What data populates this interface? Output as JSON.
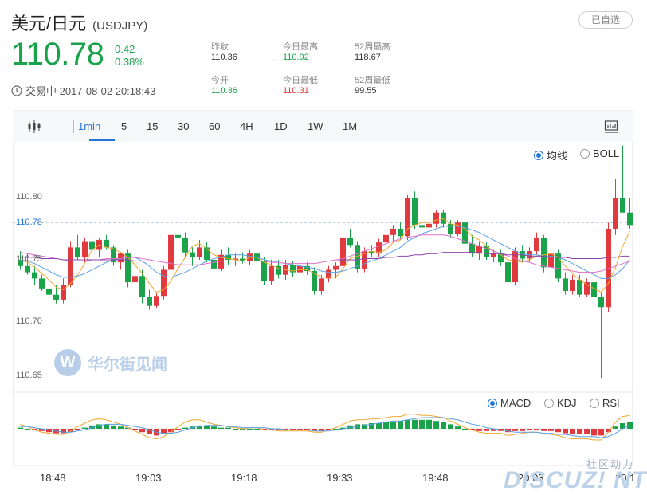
{
  "header": {
    "title": "美元/日元",
    "code": "(USDJPY)",
    "fav_label": "已自选",
    "price": "110.78",
    "change": "0.42",
    "change_pct": "0.38%",
    "status": "交易中 2017-08-02 20:18:43",
    "stats": [
      {
        "label": "昨收",
        "value": "110.36",
        "color": "#333333"
      },
      {
        "label": "今日最高",
        "value": "110.92",
        "color": "#1aa34a"
      },
      {
        "label": "52周最高",
        "value": "118.67",
        "color": "#333333"
      },
      {
        "label": "今开",
        "value": "110.36",
        "color": "#1aa34a"
      },
      {
        "label": "今日最低",
        "value": "110.31",
        "color": "#e0393e"
      },
      {
        "label": "52周最低",
        "value": "99.55",
        "color": "#333333"
      }
    ]
  },
  "toolbar": {
    "periods": [
      "1min",
      "5",
      "15",
      "30",
      "60",
      "4H",
      "1D",
      "1W",
      "1M"
    ],
    "active": "1min"
  },
  "indicators": {
    "main": [
      "均线",
      "BOLL"
    ],
    "main_active": "均线",
    "sub": [
      "MACD",
      "KDJ",
      "RSI"
    ],
    "sub_active": "MACD"
  },
  "watermark": {
    "logo": "W",
    "text": "华尔街见闻"
  },
  "forum_watermark": {
    "small": "社区动力",
    "big": "DISCUZ! NT"
  },
  "colors": {
    "up": "#e0393e",
    "down": "#1aa34a",
    "accent": "#2176d4"
  },
  "chart_data": {
    "type": "candlestick",
    "ylim": [
      110.63,
      110.86
    ],
    "yticks": [
      "110.80",
      "110.78",
      "110.75",
      "110.70",
      "110.65"
    ],
    "ytick_values": [
      110.8,
      110.78,
      110.75,
      110.7,
      110.65
    ],
    "highlight_tick": "110.78",
    "xticks": [
      "18:48",
      "19:03",
      "19:18",
      "19:33",
      "19:48",
      "20:03",
      "20:1"
    ],
    "ohlc": [
      [
        110.75,
        110.757,
        110.742,
        110.745
      ],
      [
        110.745,
        110.755,
        110.738,
        110.74
      ],
      [
        110.74,
        110.745,
        110.73,
        110.735
      ],
      [
        110.735,
        110.738,
        110.725,
        110.727
      ],
      [
        110.727,
        110.732,
        110.718,
        110.722
      ],
      [
        110.722,
        110.73,
        110.715,
        110.718
      ],
      [
        110.718,
        110.735,
        110.715,
        110.73
      ],
      [
        110.73,
        110.765,
        110.728,
        110.76
      ],
      [
        110.76,
        110.77,
        110.75,
        110.752
      ],
      [
        110.752,
        110.768,
        110.748,
        110.765
      ],
      [
        110.765,
        110.77,
        110.755,
        110.758
      ],
      [
        110.758,
        110.768,
        110.752,
        110.766
      ],
      [
        110.766,
        110.77,
        110.758,
        110.76
      ],
      [
        110.76,
        110.762,
        110.745,
        110.748
      ],
      [
        110.748,
        110.756,
        110.742,
        110.755
      ],
      [
        110.755,
        110.758,
        110.728,
        110.732
      ],
      [
        110.732,
        110.74,
        110.725,
        110.737
      ],
      [
        110.737,
        110.742,
        110.715,
        110.72
      ],
      [
        110.72,
        110.726,
        110.71,
        110.713
      ],
      [
        110.713,
        110.723,
        110.711,
        110.721
      ],
      [
        110.721,
        110.745,
        110.718,
        110.742
      ],
      [
        110.742,
        110.775,
        110.74,
        110.77
      ],
      [
        110.77,
        110.777,
        110.762,
        110.768
      ],
      [
        110.768,
        110.772,
        110.752,
        110.756
      ],
      [
        110.756,
        110.76,
        110.745,
        110.752
      ],
      [
        110.752,
        110.766,
        110.75,
        110.76
      ],
      [
        110.76,
        110.764,
        110.748,
        110.75
      ],
      [
        110.75,
        110.753,
        110.74,
        110.743
      ],
      [
        110.743,
        110.758,
        110.741,
        110.754
      ],
      [
        110.754,
        110.76,
        110.746,
        110.75
      ],
      [
        110.75,
        110.755,
        110.745,
        110.751
      ],
      [
        110.751,
        110.756,
        110.747,
        110.749
      ],
      [
        110.749,
        110.758,
        110.746,
        110.755
      ],
      [
        110.755,
        110.76,
        110.746,
        110.749
      ],
      [
        110.749,
        110.752,
        110.73,
        110.733
      ],
      [
        110.733,
        110.75,
        110.73,
        110.745
      ],
      [
        110.745,
        110.75,
        110.735,
        110.738
      ],
      [
        110.738,
        110.75,
        110.734,
        110.746
      ],
      [
        110.746,
        110.749,
        110.736,
        110.74
      ],
      [
        110.74,
        110.748,
        110.737,
        110.745
      ],
      [
        110.745,
        110.748,
        110.738,
        110.741
      ],
      [
        110.741,
        110.744,
        110.722,
        110.725
      ],
      [
        110.725,
        110.738,
        110.722,
        110.735
      ],
      [
        110.735,
        110.745,
        110.732,
        110.742
      ],
      [
        110.742,
        110.748,
        110.735,
        110.745
      ],
      [
        110.745,
        110.77,
        110.742,
        110.768
      ],
      [
        110.768,
        110.775,
        110.76,
        110.762
      ],
      [
        110.762,
        110.765,
        110.74,
        110.743
      ],
      [
        110.743,
        110.76,
        110.74,
        110.757
      ],
      [
        110.757,
        110.762,
        110.752,
        110.755
      ],
      [
        110.755,
        110.767,
        110.752,
        110.764
      ],
      [
        110.764,
        110.772,
        110.757,
        110.77
      ],
      [
        110.77,
        110.778,
        110.765,
        110.775
      ],
      [
        110.775,
        110.78,
        110.766,
        110.769
      ],
      [
        110.769,
        110.802,
        110.766,
        110.8
      ],
      [
        110.8,
        110.805,
        110.775,
        110.778
      ],
      [
        110.778,
        110.782,
        110.77,
        110.776
      ],
      [
        110.776,
        110.782,
        110.772,
        110.779
      ],
      [
        110.779,
        110.79,
        110.776,
        110.788
      ],
      [
        110.788,
        110.79,
        110.776,
        110.779
      ],
      [
        110.779,
        110.782,
        110.768,
        110.771
      ],
      [
        110.771,
        110.782,
        110.769,
        110.78
      ],
      [
        110.78,
        110.782,
        110.76,
        110.763
      ],
      [
        110.763,
        110.77,
        110.752,
        110.755
      ],
      [
        110.755,
        110.765,
        110.75,
        110.761
      ],
      [
        110.761,
        110.764,
        110.75,
        110.752
      ],
      [
        110.752,
        110.758,
        110.748,
        110.755
      ],
      [
        110.755,
        110.758,
        110.745,
        110.748
      ],
      [
        110.748,
        110.752,
        110.728,
        110.732
      ],
      [
        110.732,
        110.76,
        110.73,
        110.757
      ],
      [
        110.757,
        110.762,
        110.748,
        110.751
      ],
      [
        110.751,
        110.76,
        110.748,
        110.757
      ],
      [
        110.757,
        110.772,
        110.754,
        110.768
      ],
      [
        110.768,
        110.77,
        110.74,
        110.744
      ],
      [
        110.744,
        110.758,
        110.74,
        110.755
      ],
      [
        110.755,
        110.758,
        110.732,
        110.735
      ],
      [
        110.735,
        110.74,
        110.722,
        110.725
      ],
      [
        110.725,
        110.738,
        110.722,
        110.734
      ],
      [
        110.734,
        110.738,
        110.72,
        110.722
      ],
      [
        110.722,
        110.735,
        110.72,
        110.732
      ],
      [
        110.732,
        110.74,
        110.715,
        110.72
      ],
      [
        110.72,
        110.724,
        110.655,
        110.712
      ],
      [
        110.712,
        110.78,
        110.708,
        110.775
      ],
      [
        110.775,
        110.815,
        110.77,
        110.8
      ],
      [
        110.8,
        110.842,
        110.79,
        110.788
      ],
      [
        110.788,
        110.8,
        110.775,
        110.778
      ]
    ],
    "ma": [
      {
        "name": "MA5",
        "color": "#f0a830",
        "values": [
          110.75,
          110.748,
          110.744,
          110.739,
          110.734,
          110.728,
          110.726,
          110.731,
          110.738,
          110.747,
          110.758,
          110.762,
          110.76,
          110.759,
          110.756,
          110.752,
          110.746,
          110.739,
          110.731,
          110.724,
          110.726,
          110.733,
          110.743,
          110.752,
          110.761,
          110.763,
          110.759,
          110.754,
          110.752,
          110.751,
          110.75,
          110.749,
          110.752,
          110.752,
          110.748,
          110.746,
          110.743,
          110.742,
          110.741,
          110.742,
          110.742,
          110.739,
          110.736,
          110.736,
          110.736,
          110.743,
          110.751,
          110.753,
          110.755,
          110.757,
          110.756,
          110.758,
          110.764,
          110.766,
          110.775,
          110.778,
          110.78,
          110.78,
          110.782,
          110.783,
          110.779,
          110.778,
          110.775,
          110.769,
          110.766,
          110.761,
          110.757,
          110.754,
          110.75,
          110.749,
          110.748,
          110.75,
          110.753,
          110.754,
          110.755,
          110.752,
          110.745,
          110.739,
          110.734,
          110.73,
          110.727,
          110.724,
          110.731,
          110.744,
          110.761,
          110.773
        ]
      },
      {
        "name": "MA10",
        "color": "#5aa0e6",
        "values": [
          110.75,
          110.749,
          110.747,
          110.744,
          110.741,
          110.738,
          110.736,
          110.736,
          110.737,
          110.739,
          110.742,
          110.745,
          110.748,
          110.75,
          110.751,
          110.752,
          110.752,
          110.749,
          110.745,
          110.74,
          110.737,
          110.736,
          110.738,
          110.74,
          110.743,
          110.746,
          110.749,
          110.751,
          110.752,
          110.754,
          110.754,
          110.754,
          110.753,
          110.752,
          110.75,
          110.749,
          110.748,
          110.747,
          110.746,
          110.745,
          110.744,
          110.743,
          110.741,
          110.74,
          110.74,
          110.741,
          110.743,
          110.745,
          110.747,
          110.749,
          110.751,
          110.754,
          110.757,
          110.76,
          110.765,
          110.768,
          110.771,
          110.773,
          110.775,
          110.777,
          110.777,
          110.777,
          110.776,
          110.774,
          110.772,
          110.769,
          110.766,
          110.763,
          110.76,
          110.757,
          110.755,
          110.754,
          110.754,
          110.753,
          110.753,
          110.752,
          110.75,
          110.747,
          110.744,
          110.741,
          110.738,
          110.735,
          110.735,
          110.738,
          110.743,
          110.75
        ]
      },
      {
        "name": "MA20",
        "color": "#e070c8",
        "values": [
          110.756,
          110.755,
          110.754,
          110.753,
          110.752,
          110.751,
          110.75,
          110.749,
          110.749,
          110.749,
          110.75,
          110.75,
          110.751,
          110.751,
          110.751,
          110.752,
          110.752,
          110.751,
          110.75,
          110.749,
          110.748,
          110.747,
          110.746,
          110.746,
          110.746,
          110.746,
          110.747,
          110.748,
          110.749,
          110.749,
          110.749,
          110.749,
          110.749,
          110.749,
          110.749,
          110.748,
          110.748,
          110.747,
          110.747,
          110.747,
          110.747,
          110.747,
          110.748,
          110.749,
          110.75,
          110.751,
          110.753,
          110.755,
          110.757,
          110.759,
          110.761,
          110.763,
          110.765,
          110.767,
          110.768,
          110.769,
          110.77,
          110.77,
          110.77,
          110.77,
          110.769,
          110.767,
          110.765,
          110.763,
          110.761,
          110.759,
          110.757,
          110.755,
          110.753,
          110.751,
          110.749,
          110.748,
          110.746,
          110.745,
          110.744,
          110.743,
          110.742,
          110.741,
          110.74,
          110.74,
          110.74,
          110.741,
          110.743,
          110.745,
          110.747,
          110.749
        ]
      },
      {
        "name": "MA60",
        "color": "#8e44ad",
        "values": [
          110.752,
          110.752,
          110.752,
          110.751,
          110.751,
          110.751,
          110.75,
          110.75,
          110.75,
          110.75,
          110.75,
          110.75,
          110.75,
          110.75,
          110.75,
          110.75,
          110.749,
          110.749,
          110.749,
          110.749,
          110.749,
          110.749,
          110.749,
          110.749,
          110.749,
          110.749,
          110.749,
          110.749,
          110.749,
          110.749,
          110.749,
          110.749,
          110.749,
          110.749,
          110.749,
          110.749,
          110.749,
          110.749,
          110.749,
          110.749,
          110.749,
          110.749,
          110.749,
          110.749,
          110.749,
          110.75,
          110.75,
          110.75,
          110.751,
          110.751,
          110.751,
          110.752,
          110.752,
          110.753,
          110.753,
          110.754,
          110.754,
          110.755,
          110.755,
          110.756,
          110.756,
          110.756,
          110.756,
          110.756,
          110.756,
          110.755,
          110.755,
          110.755,
          110.754,
          110.754,
          110.754,
          110.753,
          110.753,
          110.753,
          110.752,
          110.752,
          110.752,
          110.751,
          110.751,
          110.751,
          110.751,
          110.751,
          110.752,
          110.752,
          110.753,
          110.753
        ]
      }
    ],
    "macd": {
      "hist": [
        0.1,
        0.0,
        -0.1,
        -0.2,
        -0.3,
        -0.4,
        -0.4,
        -0.3,
        -0.1,
        0.1,
        0.3,
        0.4,
        0.4,
        0.3,
        0.2,
        0.1,
        -0.1,
        -0.3,
        -0.5,
        -0.6,
        -0.5,
        -0.3,
        -0.1,
        0.1,
        0.2,
        0.3,
        0.3,
        0.2,
        0.1,
        0.1,
        0.0,
        0.0,
        0.0,
        0.0,
        -0.1,
        -0.1,
        -0.1,
        -0.1,
        -0.1,
        -0.1,
        -0.1,
        -0.2,
        -0.2,
        -0.1,
        0.0,
        0.1,
        0.3,
        0.4,
        0.4,
        0.5,
        0.5,
        0.6,
        0.6,
        0.7,
        0.8,
        0.8,
        0.8,
        0.8,
        0.7,
        0.6,
        0.4,
        0.2,
        0.0,
        -0.1,
        -0.2,
        -0.2,
        -0.2,
        -0.2,
        -0.3,
        -0.2,
        -0.2,
        -0.1,
        -0.1,
        -0.2,
        -0.2,
        -0.3,
        -0.4,
        -0.5,
        -0.5,
        -0.5,
        -0.6,
        -0.6,
        -0.3,
        0.2,
        0.5,
        0.6
      ],
      "dif": [
        0.4,
        0.2,
        -0.1,
        -0.3,
        -0.4,
        -0.5,
        -0.5,
        -0.2,
        0.2,
        0.5,
        0.8,
        0.9,
        0.8,
        0.6,
        0.4,
        0.1,
        -0.2,
        -0.5,
        -0.8,
        -0.9,
        -0.7,
        -0.3,
        0.2,
        0.6,
        0.8,
        0.8,
        0.6,
        0.4,
        0.3,
        0.2,
        0.1,
        0.0,
        0.1,
        0.1,
        -0.1,
        -0.1,
        -0.2,
        -0.2,
        -0.2,
        -0.2,
        -0.2,
        -0.3,
        -0.3,
        -0.1,
        0.1,
        0.4,
        0.7,
        0.8,
        0.8,
        0.9,
        0.9,
        1.0,
        1.1,
        1.1,
        1.3,
        1.3,
        1.2,
        1.2,
        1.1,
        1.0,
        0.7,
        0.4,
        0.1,
        -0.1,
        -0.3,
        -0.4,
        -0.4,
        -0.4,
        -0.6,
        -0.5,
        -0.4,
        -0.3,
        -0.3,
        -0.4,
        -0.5,
        -0.6,
        -0.8,
        -0.9,
        -0.9,
        -0.9,
        -1.0,
        -1.0,
        -0.3,
        0.6,
        1.1,
        1.2
      ],
      "dea": [
        0.2,
        0.2,
        0.1,
        0.0,
        -0.1,
        -0.2,
        -0.3,
        -0.3,
        -0.2,
        -0.1,
        0.1,
        0.3,
        0.4,
        0.4,
        0.4,
        0.3,
        0.2,
        0.1,
        -0.1,
        -0.3,
        -0.4,
        -0.4,
        -0.3,
        -0.1,
        0.1,
        0.2,
        0.3,
        0.3,
        0.3,
        0.2,
        0.2,
        0.1,
        0.1,
        0.1,
        0.1,
        0.0,
        0.0,
        -0.1,
        -0.1,
        -0.1,
        -0.1,
        -0.2,
        -0.2,
        -0.2,
        -0.1,
        0.0,
        0.1,
        0.2,
        0.3,
        0.4,
        0.5,
        0.6,
        0.7,
        0.7,
        0.8,
        0.9,
        1.0,
        1.0,
        1.0,
        1.0,
        0.9,
        0.8,
        0.6,
        0.4,
        0.3,
        0.1,
        0.0,
        -0.1,
        -0.2,
        -0.3,
        -0.3,
        -0.3,
        -0.3,
        -0.4,
        -0.4,
        -0.5,
        -0.5,
        -0.6,
        -0.7,
        -0.7,
        -0.7,
        -0.8,
        -0.7,
        -0.4,
        0.0,
        0.3
      ]
    }
  }
}
